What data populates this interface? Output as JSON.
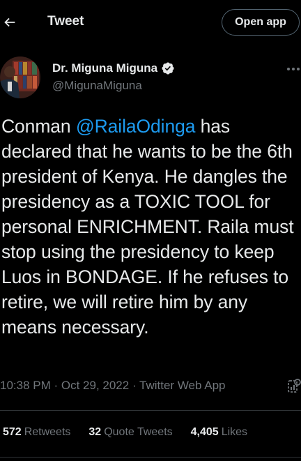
{
  "header": {
    "title": "Tweet",
    "back_icon": "back-arrow-icon",
    "open_app_label": "Open app"
  },
  "author": {
    "name": "Dr. Miguna Miguna",
    "handle": "@MigunaMiguna",
    "verified": true,
    "verified_color": "#e7e9ea"
  },
  "tweet": {
    "text_before_mention": "Conman ",
    "mention": "@RailaOdinga",
    "text_after_mention": " has declared that he wants to be the 6th president of Kenya. He dangles the presidency as a TOXIC TOOL for personal ENRICHMENT. Raila must stop using the presidency to keep Luos in BONDAGE. If he refuses to retire, we will retire him by any means necessary.",
    "mention_color": "#1d9bf0"
  },
  "meta": {
    "time": "10:38 PM",
    "separator": " · ",
    "date": "Oct 29, 2022",
    "source": "Twitter Web App"
  },
  "stats": {
    "retweets_count": "572",
    "retweets_label": "Retweets",
    "quotes_count": "32",
    "quotes_label": "Quote Tweets",
    "likes_count": "4,405",
    "likes_label": "Likes"
  },
  "colors": {
    "background": "#000000",
    "text_primary": "#e7e9ea",
    "text_secondary": "#71767b",
    "accent": "#1d9bf0",
    "divider": "#2f3336"
  }
}
